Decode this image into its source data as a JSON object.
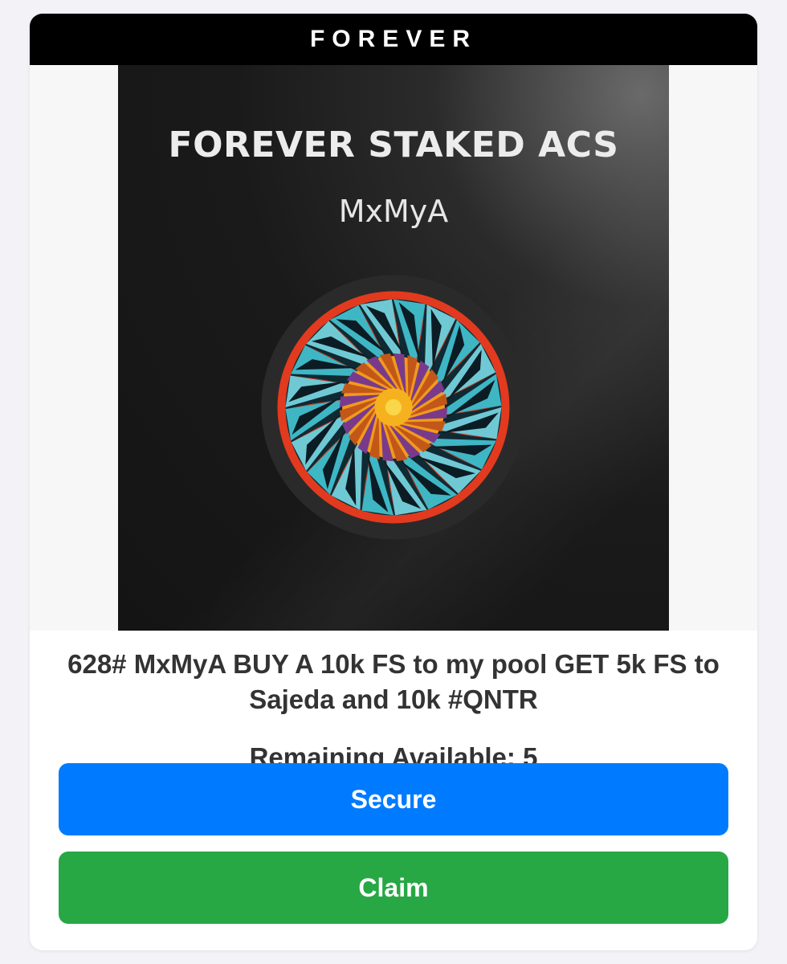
{
  "header": {
    "brand": "FOREVER"
  },
  "artwork": {
    "title": "FOREVER STAKED ACS",
    "subtitle": "MxMyA",
    "icon": "mandala-artwork"
  },
  "listing": {
    "title": "628# MxMyA BUY A 10k FS to my pool GET 5k FS to Sajeda and 10k #QNTR",
    "remaining_label": "Remaining Available:",
    "remaining_count": "5"
  },
  "actions": {
    "secure_label": "Secure",
    "claim_label": "Claim"
  },
  "colors": {
    "header_bg": "#000000",
    "secure_button": "#007bff",
    "claim_button": "#28a745",
    "text": "#333333"
  }
}
